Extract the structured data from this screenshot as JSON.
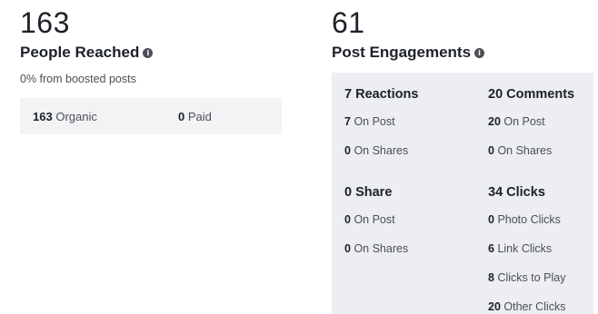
{
  "reach": {
    "count": "163",
    "title": "People Reached",
    "info_icon": "info-icon",
    "subtitle": "0% from boosted posts",
    "organic_value": "163",
    "organic_label": "Organic",
    "paid_value": "0",
    "paid_label": "Paid"
  },
  "engagements": {
    "count": "61",
    "title": "Post Engagements",
    "info_icon": "info-icon",
    "reactions": {
      "heading": "7 Reactions",
      "on_post_value": "7",
      "on_post_label": "On Post",
      "on_shares_value": "0",
      "on_shares_label": "On Shares"
    },
    "comments": {
      "heading": "20 Comments",
      "on_post_value": "20",
      "on_post_label": "On Post",
      "on_shares_value": "0",
      "on_shares_label": "On Shares"
    },
    "shares": {
      "heading": "0 Share",
      "on_post_value": "0",
      "on_post_label": "On Post",
      "on_shares_value": "0",
      "on_shares_label": "On Shares"
    },
    "clicks": {
      "heading": "34 Clicks",
      "photo_value": "0",
      "photo_label": "Photo Clicks",
      "link_value": "6",
      "link_label": "Link Clicks",
      "play_value": "8",
      "play_label": "Clicks to Play",
      "other_value": "20",
      "other_label": "Other Clicks"
    }
  }
}
